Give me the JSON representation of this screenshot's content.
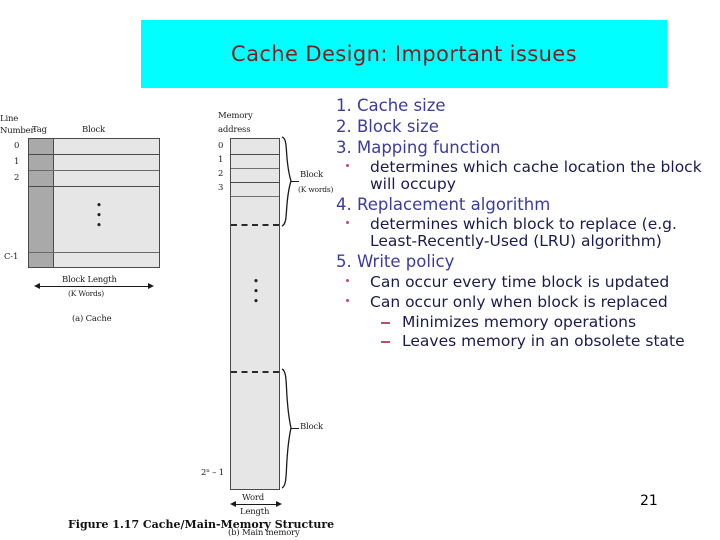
{
  "slide": {
    "title": "Cache Design: Important issues",
    "page_number": "21",
    "banner_color": "#00ffff",
    "title_color": "#7a1f1f"
  },
  "content": {
    "items": [
      {
        "kind": "number",
        "text": "1. Cache size"
      },
      {
        "kind": "number",
        "text": "2. Block size"
      },
      {
        "kind": "number",
        "text": "3. Mapping function"
      },
      {
        "kind": "bullet",
        "text": "determines which cache location the block will occupy"
      },
      {
        "kind": "number",
        "text": "4. Replacement algorithm"
      },
      {
        "kind": "bullet",
        "text": "determines which block to replace (e.g. Least-Recently-Used (LRU) algorithm)"
      },
      {
        "kind": "number",
        "text": "5. Write policy"
      },
      {
        "kind": "bullet",
        "text": "Can occur every time block is updated"
      },
      {
        "kind": "bullet",
        "text": "Can occur only when block is replaced"
      },
      {
        "kind": "dash",
        "text": "Minimizes memory operations"
      },
      {
        "kind": "dash",
        "text": "Leaves memory in an obsolete state"
      }
    ]
  },
  "figure": {
    "caption": "Figure 1.17  Cache/Main-Memory Structure",
    "cache": {
      "header_line_number": "Line",
      "header_line_number2": "Number",
      "header_tag": "Tag",
      "header_block": "Block",
      "row_labels": [
        "0",
        "1",
        "2",
        "C-1"
      ],
      "dots": "•\n•\n•",
      "width_label": "Block Length",
      "width_sublabel": "(K Words)",
      "subcaption": "(a) Cache"
    },
    "memory": {
      "header_1": "Memory",
      "header_2": "address",
      "row_labels": [
        "0",
        "1",
        "2",
        "3"
      ],
      "last_label": "2ⁿ – 1",
      "brace_label_top": "Block",
      "brace_sublabel_top": "(K words)",
      "brace_label_bottom": "Block",
      "width_label": "Word",
      "width_sublabel": "Length",
      "subcaption": "(b) Main memory",
      "dots": "•\n•\n•"
    }
  }
}
